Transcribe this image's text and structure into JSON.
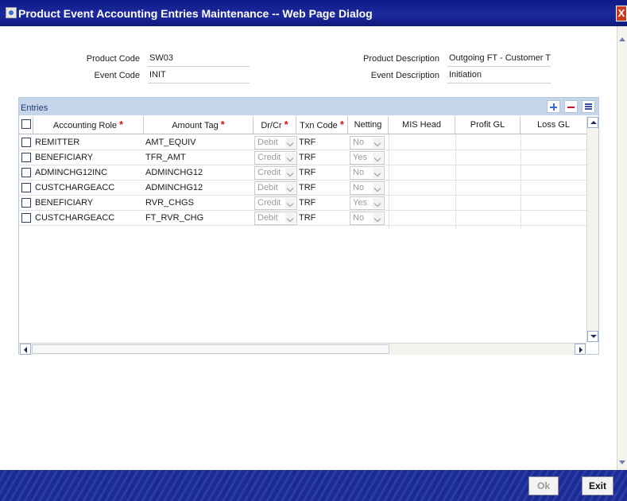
{
  "window": {
    "title": "Product Event Accounting Entries Maintenance -- Web Page Dialog",
    "close_label": "X"
  },
  "form": {
    "product_code_label": "Product Code",
    "product_code": "SW03",
    "event_code_label": "Event Code",
    "event_code": "INIT",
    "product_description_label": "Product Description",
    "product_description": "Outgoing FT - Customer Tr",
    "event_description_label": "Event Description",
    "event_description": "Initiation"
  },
  "entries": {
    "title": "Entries",
    "columns": [
      "Accounting Role",
      "Amount Tag",
      "Dr/Cr",
      "Txn Code",
      "Netting",
      "MIS Head",
      "Profit GL",
      "Loss GL"
    ],
    "required_marker": "*",
    "rows": [
      {
        "role": "REMITTER",
        "amount_tag": "AMT_EQUIV",
        "drcr": "Debit",
        "txn_code": "TRF",
        "netting": "No"
      },
      {
        "role": "BENEFICIARY",
        "amount_tag": "TFR_AMT",
        "drcr": "Credit",
        "txn_code": "TRF",
        "netting": "Yes"
      },
      {
        "role": "ADMINCHG12INC",
        "amount_tag": "ADMINCHG12",
        "drcr": "Credit",
        "txn_code": "TRF",
        "netting": "No"
      },
      {
        "role": "CUSTCHARGEACC",
        "amount_tag": "ADMINCHG12",
        "drcr": "Debit",
        "txn_code": "TRF",
        "netting": "No"
      },
      {
        "role": "BENEFICIARY",
        "amount_tag": "RVR_CHGS",
        "drcr": "Credit",
        "txn_code": "TRF",
        "netting": "Yes"
      },
      {
        "role": "CUSTCHARGEACC",
        "amount_tag": "FT_RVR_CHG",
        "drcr": "Debit",
        "txn_code": "TRF",
        "netting": "No"
      }
    ]
  },
  "footer": {
    "ok_label": "Ok",
    "exit_label": "Exit"
  }
}
